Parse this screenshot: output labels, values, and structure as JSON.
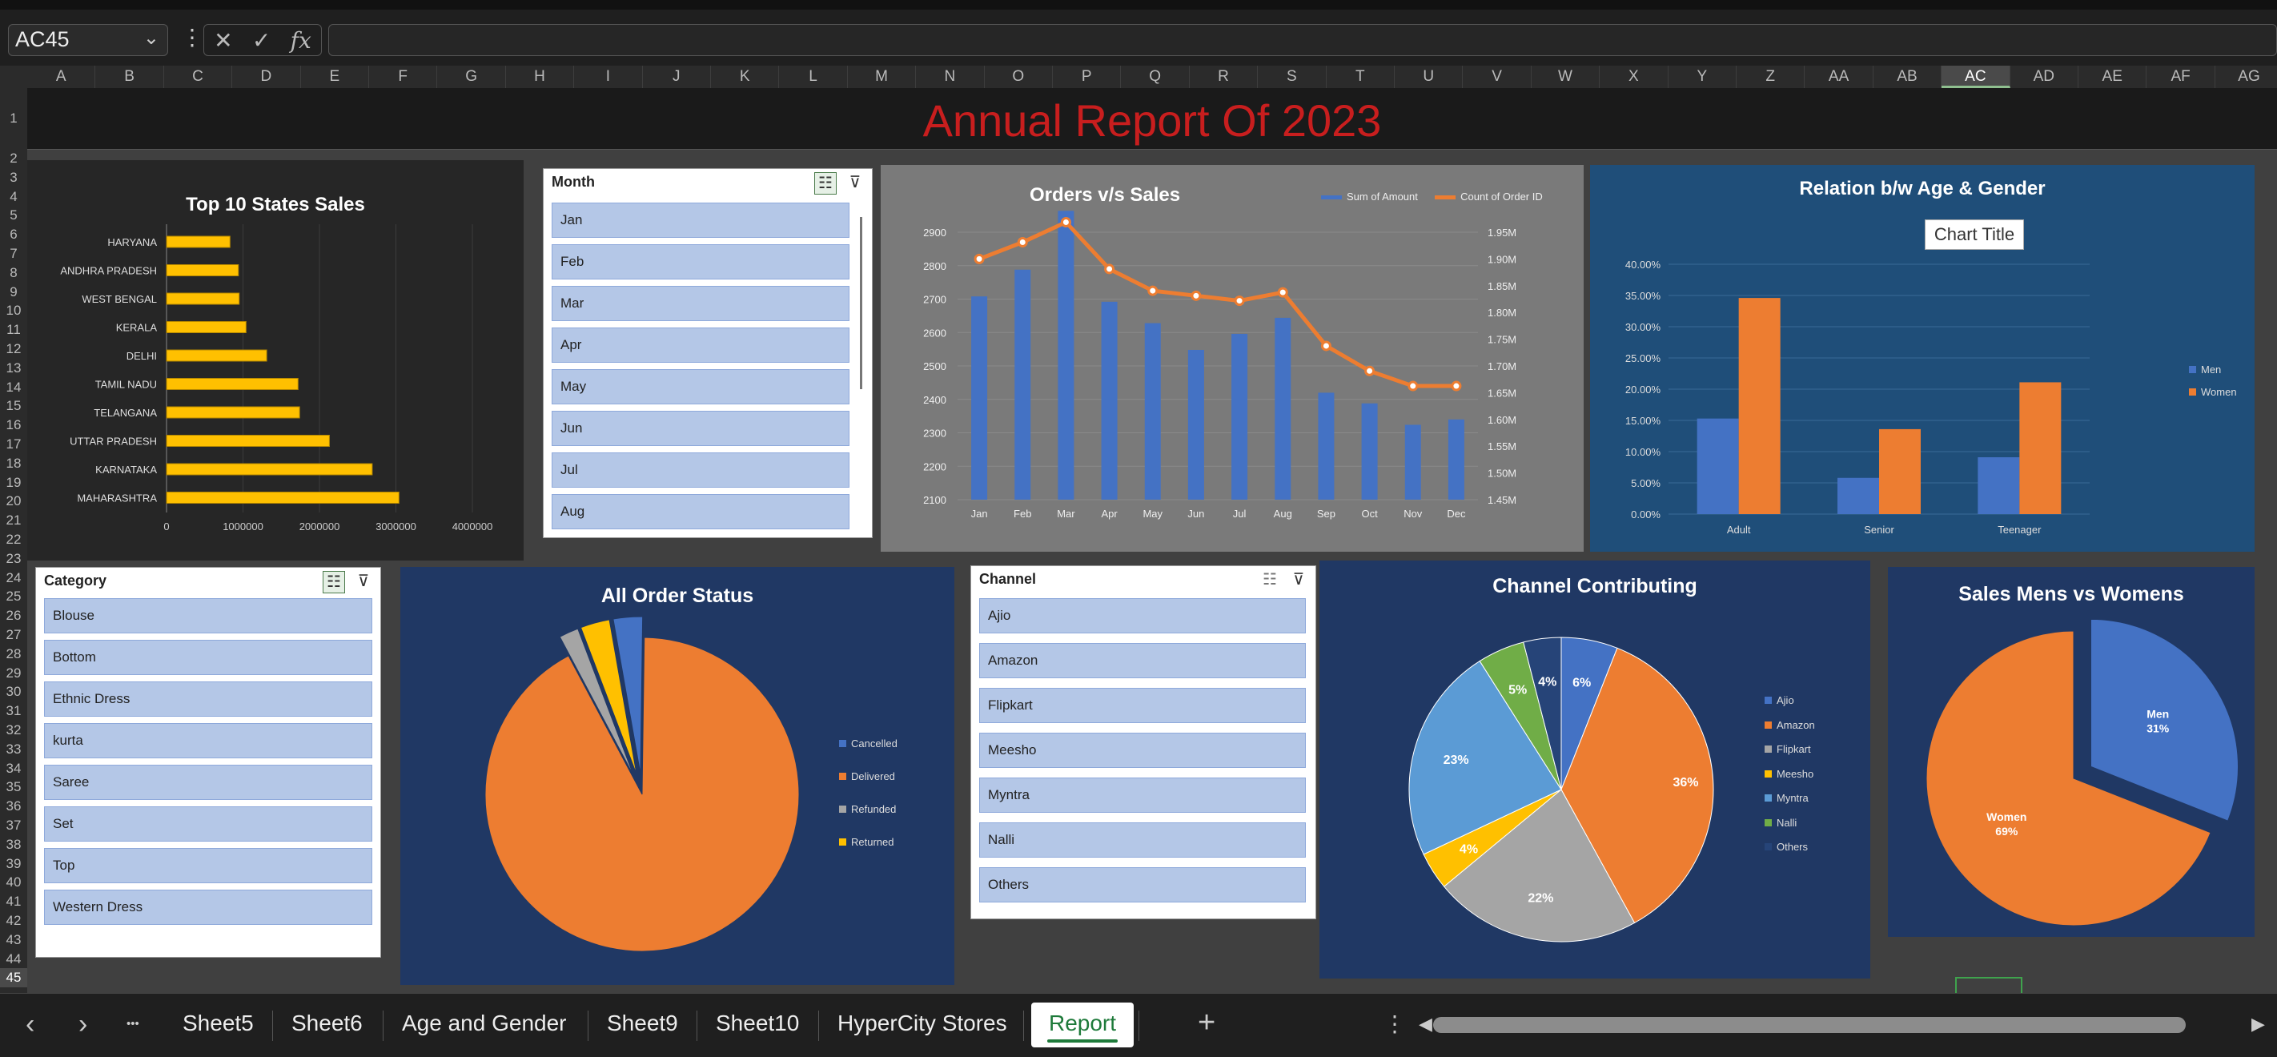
{
  "formula_bar": {
    "name_box": "AC45",
    "fx": "fx",
    "cancel": "✕",
    "enter": "✓",
    "formula": ""
  },
  "columns": [
    "A",
    "B",
    "C",
    "D",
    "E",
    "F",
    "G",
    "H",
    "I",
    "J",
    "K",
    "L",
    "M",
    "N",
    "O",
    "P",
    "Q",
    "R",
    "S",
    "T",
    "U",
    "V",
    "W",
    "X",
    "Y",
    "Z",
    "AA",
    "AB",
    "AC",
    "AD",
    "AE",
    "AF",
    "AG"
  ],
  "selected_column": "AC",
  "rows": [
    "1",
    "2",
    "3",
    "4",
    "5",
    "6",
    "7",
    "8",
    "9",
    "10",
    "11",
    "12",
    "13",
    "14",
    "15",
    "16",
    "17",
    "18",
    "19",
    "20",
    "21",
    "22",
    "23",
    "24",
    "25",
    "26",
    "27",
    "28",
    "29",
    "30",
    "31",
    "32",
    "33",
    "34",
    "35",
    "36",
    "37",
    "38",
    "39",
    "40",
    "41",
    "42",
    "43",
    "44",
    "45"
  ],
  "selected_row": "45",
  "report_title": "Annual Report Of 2023",
  "colors": {
    "title_red": "#c81e1e",
    "slicer_item": "#b4c7e7",
    "men_blue": "#4472c4",
    "women_orange": "#ed7d31",
    "bar_gold": "#ffc000"
  },
  "slicers": {
    "month": {
      "header": "Month",
      "items": [
        "Jan",
        "Feb",
        "Mar",
        "Apr",
        "May",
        "Jun",
        "Jul",
        "Aug"
      ]
    },
    "category": {
      "header": "Category",
      "items": [
        "Blouse",
        "Bottom",
        "Ethnic Dress",
        "kurta",
        "Saree",
        "Set",
        "Top",
        "Western Dress"
      ]
    },
    "channel": {
      "header": "Channel",
      "items": [
        "Ajio",
        "Amazon",
        "Flipkart",
        "Meesho",
        "Myntra",
        "Nalli",
        "Others"
      ]
    }
  },
  "chart_data": [
    {
      "id": "top-states",
      "type": "bar",
      "orientation": "horizontal",
      "title": "Top 10 States Sales",
      "categories": [
        "HARYANA",
        "ANDHRA PRADESH",
        "WEST BENGAL",
        "KERALA",
        "DELHI",
        "TAMIL NADU",
        "TELANGANA",
        "UTTAR PRADESH",
        "KARNATAKA",
        "MAHARASHTRA"
      ],
      "values": [
        830000,
        940000,
        950000,
        1040000,
        1310000,
        1720000,
        1740000,
        2130000,
        2690000,
        3040000
      ],
      "xticks": [
        "0",
        "1000000",
        "2000000",
        "3000000",
        "4000000"
      ],
      "xlim": [
        0,
        4000000
      ]
    },
    {
      "id": "orders-sales",
      "type": "bar+line",
      "title": "Orders v/s Sales",
      "categories": [
        "Jan",
        "Feb",
        "Mar",
        "Apr",
        "May",
        "Jun",
        "Jul",
        "Aug",
        "Sep",
        "Oct",
        "Nov",
        "Dec"
      ],
      "series": [
        {
          "name": "Sum of Amount",
          "type": "bar",
          "axis": "right",
          "values": [
            1830000,
            1880000,
            1990000,
            1820000,
            1780000,
            1730000,
            1760000,
            1790000,
            1650000,
            1630000,
            1590000,
            1600000
          ]
        },
        {
          "name": "Count of Order ID",
          "type": "line",
          "axis": "left",
          "values": [
            2820,
            2870,
            2930,
            2790,
            2725,
            2710,
            2695,
            2720,
            2560,
            2485,
            2440,
            2440
          ]
        }
      ],
      "left_ticks": [
        "2100",
        "2200",
        "2300",
        "2400",
        "2500",
        "2600",
        "2700",
        "2800",
        "2900"
      ],
      "left_lim": [
        2100,
        2900
      ],
      "right_ticks": [
        "1.45M",
        "1.50M",
        "1.55M",
        "1.60M",
        "1.65M",
        "1.70M",
        "1.75M",
        "1.80M",
        "1.85M",
        "1.90M",
        "1.95M"
      ],
      "right_lim": [
        1450000,
        1950000
      ]
    },
    {
      "id": "age-gender",
      "type": "bar",
      "title": "Relation b/w Age & Gender",
      "subtitle": "Chart Title",
      "categories": [
        "Adult",
        "Senior",
        "Teenager"
      ],
      "series": [
        {
          "name": "Men",
          "values": [
            15.3,
            5.8,
            9.1
          ]
        },
        {
          "name": "Women",
          "values": [
            34.6,
            13.6,
            21.1
          ]
        }
      ],
      "yticks": [
        "0.00%",
        "5.00%",
        "10.00%",
        "15.00%",
        "20.00%",
        "25.00%",
        "30.00%",
        "35.00%",
        "40.00%"
      ],
      "ylim": [
        0,
        40
      ]
    },
    {
      "id": "order-status",
      "type": "pie",
      "title": "All Order Status",
      "labels": [
        "Cancelled",
        "Delivered",
        "Refunded",
        "Returned"
      ],
      "values": [
        3,
        92,
        2,
        3
      ]
    },
    {
      "id": "channel",
      "type": "pie",
      "title": "Channel Contributing",
      "labels": [
        "Ajio",
        "Amazon",
        "Flipkart",
        "Meesho",
        "Myntra",
        "Nalli",
        "Others"
      ],
      "values": [
        6,
        36,
        22,
        4,
        23,
        5,
        4
      ],
      "data_labels": [
        "6%",
        "36%",
        "22%",
        "4%",
        "23%",
        "5%",
        "4%"
      ]
    },
    {
      "id": "men-women",
      "type": "pie",
      "title": "Sales Mens vs Womens",
      "labels": [
        "Men",
        "Women"
      ],
      "values": [
        31,
        69
      ],
      "data_labels": [
        "31%",
        "69%"
      ]
    }
  ],
  "sheet_tabs": [
    "Sheet5",
    "Sheet6",
    "Age and Gender",
    "Sheet9",
    "Sheet10",
    "HyperCity Stores",
    "Report"
  ],
  "active_tab": "Report",
  "tab_nav": {
    "prev": "‹",
    "next": "›",
    "more": "•••",
    "add": "+",
    "options": "⋮"
  }
}
